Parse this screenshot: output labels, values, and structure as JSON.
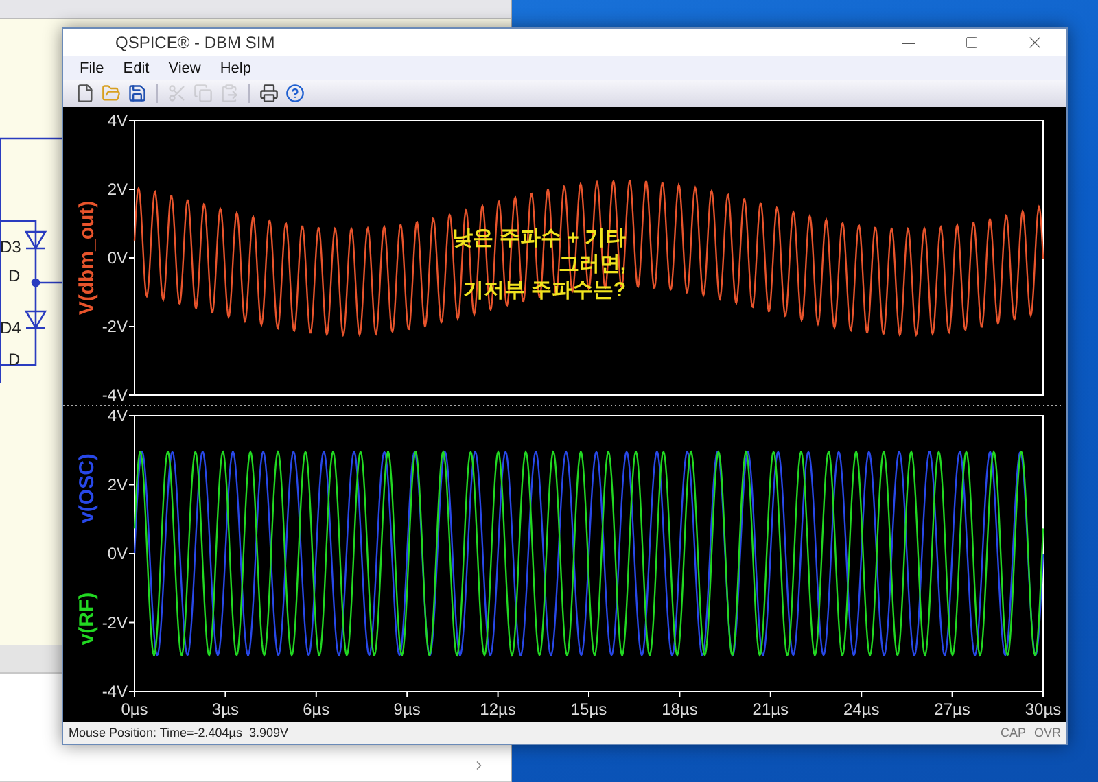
{
  "background_window": {
    "labels": [
      "D3",
      "D",
      "D4",
      "D"
    ]
  },
  "window": {
    "title": "QSPICE® - DBM SIM"
  },
  "menu": [
    "File",
    "Edit",
    "View",
    "Help"
  ],
  "toolbar": [
    {
      "kind": "new",
      "disabled": false
    },
    {
      "kind": "open",
      "disabled": false
    },
    {
      "kind": "save",
      "disabled": false
    },
    {
      "kind": "separator"
    },
    {
      "kind": "cut",
      "disabled": true
    },
    {
      "kind": "copy",
      "disabled": true
    },
    {
      "kind": "paste",
      "disabled": true
    },
    {
      "kind": "separator"
    },
    {
      "kind": "print",
      "disabled": false
    },
    {
      "kind": "help",
      "disabled": false
    }
  ],
  "plots": [
    {
      "traces": [
        {
          "name": "V(dbm_out)",
          "color": "#e8542c"
        }
      ],
      "yticks": [
        "4V",
        "2V",
        "0V",
        "-2V",
        "-4V"
      ]
    },
    {
      "traces": [
        {
          "name": "v(OSC)",
          "color": "#2848e8"
        },
        {
          "name": "v(RF)",
          "color": "#22d822"
        }
      ],
      "yticks": [
        "4V",
        "2V",
        "0V",
        "-2V",
        "-4V"
      ]
    }
  ],
  "xticks": [
    "0µs",
    "3µs",
    "6µs",
    "9µs",
    "12µs",
    "15µs",
    "18µs",
    "21µs",
    "24µs",
    "27µs",
    "30µs"
  ],
  "annotation": {
    "lines": [
      "낮은 주파수 + 기타",
      "그러면,",
      "기저부 주파수는?"
    ]
  },
  "status_bar": {
    "text": "Mouse Position: Time=-2.404µs  3.909V",
    "indicators": [
      "CAP",
      "OVR"
    ]
  }
}
